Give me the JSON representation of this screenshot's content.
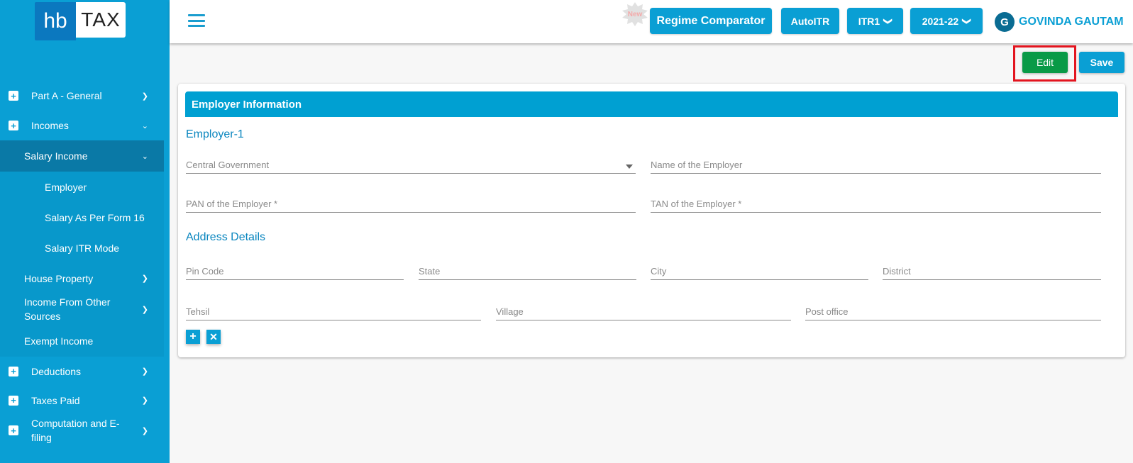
{
  "logo": {
    "part1": "hb",
    "part2": "TAX"
  },
  "sidebar": {
    "items": [
      {
        "label": "Part A - General",
        "expanded": false
      },
      {
        "label": "Incomes",
        "expanded": true
      },
      {
        "label": "Salary Income",
        "expanded": true,
        "active": true
      },
      {
        "label": "Employer"
      },
      {
        "label": "Salary As Per Form 16"
      },
      {
        "label": "Salary ITR Mode"
      },
      {
        "label": "House Property"
      },
      {
        "label": "Income From Other Sources"
      },
      {
        "label": "Exempt Income"
      },
      {
        "label": "Deductions"
      },
      {
        "label": "Taxes Paid"
      },
      {
        "label": "Computation and E-filing"
      }
    ]
  },
  "header": {
    "new_badge": "New",
    "regime_comparator": "Regime Comparator",
    "auto_itr": "AutoITR",
    "itr_form": "ITR1",
    "assessment_year": "2021-22",
    "user_initial": "G",
    "user_name": "GOVINDA GAUTAM"
  },
  "actions": {
    "edit": "Edit",
    "save": "Save"
  },
  "card": {
    "title": "Employer Information",
    "employer_section": "Employer-1",
    "employer_type": "Central Government",
    "employer_name_placeholder": "Name of the Employer",
    "pan_placeholder": "PAN of the Employer *",
    "tan_placeholder": "TAN of the Employer *",
    "address_section": "Address Details",
    "pin_placeholder": "Pin Code",
    "state_placeholder": "State",
    "city_placeholder": "City",
    "district_placeholder": "District",
    "tehsil_placeholder": "Tehsil",
    "village_placeholder": "Village",
    "post_office_placeholder": "Post office",
    "add_symbol": "+",
    "remove_symbol": "✕"
  },
  "colors": {
    "primary": "#0a9fd4",
    "edit": "#099a47",
    "highlight": "#e3151f"
  }
}
